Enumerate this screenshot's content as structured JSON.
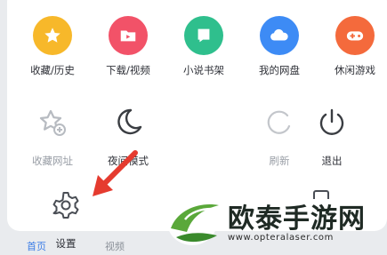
{
  "menu": {
    "row1": [
      {
        "label": "收藏/历史",
        "icon": "star-icon",
        "color": "#f7b82a"
      },
      {
        "label": "下载/视频",
        "icon": "folder-play-icon",
        "color": "#f25268"
      },
      {
        "label": "小说书架",
        "icon": "book-icon",
        "color": "#2fbf8d"
      },
      {
        "label": "我的网盘",
        "icon": "cloud-icon",
        "color": "#3d8bf5"
      },
      {
        "label": "休闲游戏",
        "icon": "gamepad-icon",
        "color": "#f46a3c"
      }
    ],
    "row2": [
      {
        "label": "收藏网址",
        "icon": "star-add-icon"
      },
      {
        "label": "夜间模式",
        "icon": "moon-icon"
      },
      {
        "label": "刷新",
        "icon": "refresh-icon"
      },
      {
        "label": "退出",
        "icon": "power-icon"
      }
    ],
    "settings": {
      "label": "设置",
      "icon": "gear-icon"
    }
  },
  "bottom_nav": {
    "home": "首页",
    "video": "视频"
  },
  "watermark": {
    "title": "欧泰手游网",
    "url": "www.opteralaser.com"
  },
  "colors": {
    "arrow": "#e53b2f",
    "watermark_green": "#5aa83a"
  }
}
